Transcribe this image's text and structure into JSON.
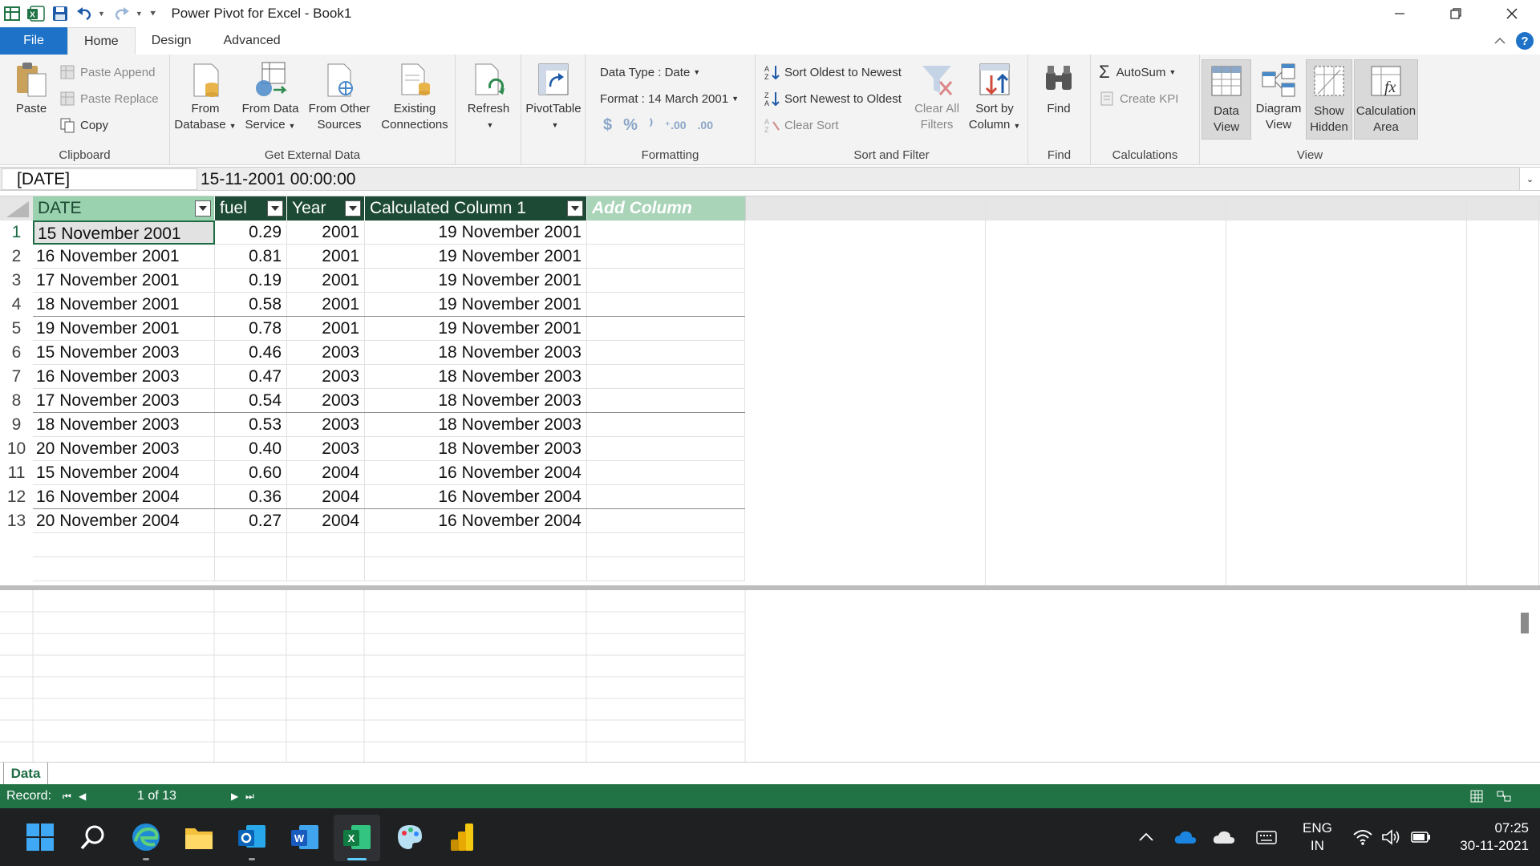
{
  "window": {
    "title": "Power Pivot for Excel - Book1"
  },
  "ribbon_tabs": [
    {
      "label": "File"
    },
    {
      "label": "Home"
    },
    {
      "label": "Design"
    },
    {
      "label": "Advanced"
    }
  ],
  "clipboard": {
    "paste": "Paste",
    "paste_append": "Paste Append",
    "paste_replace": "Paste Replace",
    "copy": "Copy",
    "group_label": "Clipboard"
  },
  "external": {
    "from_database": [
      "From",
      "Database"
    ],
    "from_data_service": [
      "From Data",
      "Service"
    ],
    "from_other_sources": [
      "From Other",
      "Sources"
    ],
    "existing_connections": [
      "Existing",
      "Connections"
    ],
    "group_label": "Get External Data"
  },
  "refresh": {
    "label": "Refresh"
  },
  "pivottable": {
    "label": "PivotTable"
  },
  "formatting": {
    "data_type": "Data Type : Date",
    "format": "Format : 14 March 2001",
    "group_label": "Formatting"
  },
  "sort_filter": {
    "sort_oldest": "Sort Oldest to Newest",
    "sort_newest": "Sort Newest to Oldest",
    "clear_sort": "Clear Sort",
    "clear_all_filters": [
      "Clear All",
      "Filters"
    ],
    "sort_by_column": [
      "Sort by",
      "Column"
    ],
    "group_label": "Sort and Filter"
  },
  "find": {
    "label": "Find",
    "group_label": "Find"
  },
  "calculations": {
    "autosum": "AutoSum",
    "create_kpi": "Create KPI",
    "group_label": "Calculations"
  },
  "view": {
    "data_view": [
      "Data",
      "View"
    ],
    "diagram_view": [
      "Diagram",
      "View"
    ],
    "show_hidden": [
      "Show",
      "Hidden"
    ],
    "calculation_area": [
      "Calculation",
      "Area"
    ],
    "group_label": "View"
  },
  "formula_bar": {
    "name_box": "[DATE]",
    "value": "15-11-2001 00:00:00"
  },
  "table": {
    "columns": [
      "DATE",
      "fuel",
      "Year",
      "Calculated Column 1"
    ],
    "add_column": "Add Column",
    "rows": [
      {
        "n": "1",
        "date": "15 November 2001",
        "fuel": "0.29",
        "year": "2001",
        "calc": "19 November 2001"
      },
      {
        "n": "2",
        "date": "16 November 2001",
        "fuel": "0.81",
        "year": "2001",
        "calc": "19 November 2001"
      },
      {
        "n": "3",
        "date": "17 November 2001",
        "fuel": "0.19",
        "year": "2001",
        "calc": "19 November 2001"
      },
      {
        "n": "4",
        "date": "18 November 2001",
        "fuel": "0.58",
        "year": "2001",
        "calc": "19 November 2001"
      },
      {
        "n": "5",
        "date": "19 November 2001",
        "fuel": "0.78",
        "year": "2001",
        "calc": "19 November 2001"
      },
      {
        "n": "6",
        "date": "15 November 2003",
        "fuel": "0.46",
        "year": "2003",
        "calc": "18 November 2003"
      },
      {
        "n": "7",
        "date": "16 November 2003",
        "fuel": "0.47",
        "year": "2003",
        "calc": "18 November 2003"
      },
      {
        "n": "8",
        "date": "17 November 2003",
        "fuel": "0.54",
        "year": "2003",
        "calc": "18 November 2003"
      },
      {
        "n": "9",
        "date": "18 November 2003",
        "fuel": "0.53",
        "year": "2003",
        "calc": "18 November 2003"
      },
      {
        "n": "10",
        "date": "20 November 2003",
        "fuel": "0.40",
        "year": "2003",
        "calc": "18 November 2003"
      },
      {
        "n": "11",
        "date": "15 November 2004",
        "fuel": "0.60",
        "year": "2004",
        "calc": "16 November 2004"
      },
      {
        "n": "12",
        "date": "16 November 2004",
        "fuel": "0.36",
        "year": "2004",
        "calc": "16 November 2004"
      },
      {
        "n": "13",
        "date": "20 November 2004",
        "fuel": "0.27",
        "year": "2004",
        "calc": "16 November 2004"
      }
    ]
  },
  "sheet_tab": "Data",
  "status": {
    "record": "Record:",
    "position": "1 of 13"
  },
  "taskbar": {
    "language_top": "ENG",
    "language_bottom": "IN",
    "time": "07:25",
    "date": "30-11-2021"
  },
  "colors": {
    "accent": "#217346",
    "header_dark": "#1d4a34",
    "file_tab": "#1e73c8"
  }
}
